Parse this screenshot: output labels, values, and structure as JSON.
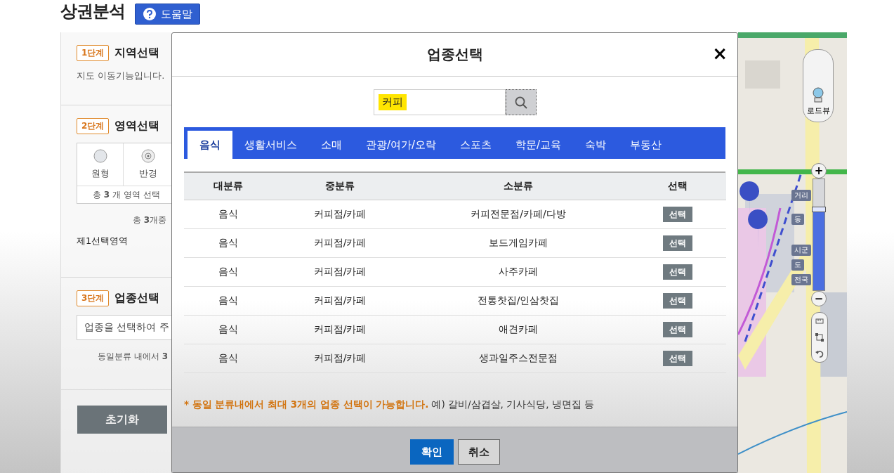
{
  "page": {
    "title": "상권분석",
    "help_button": "도움말"
  },
  "left_panel": {
    "step1": {
      "badge": "1단계",
      "title": "지역선택",
      "note": "지도 이동기능입니다."
    },
    "step2": {
      "badge": "2단계",
      "title": "영역선택",
      "shapes": [
        {
          "kind": "circle",
          "label": "원형"
        },
        {
          "kind": "radius",
          "label": "반경"
        }
      ],
      "area_count": "총 **3** 개 영역 선택",
      "selected_count": "총 **3**개중",
      "area_item": "제1선택영역"
    },
    "step3": {
      "badge": "3단계",
      "title": "업종선택",
      "field_placeholder": "업종을 선택하여 주",
      "note": "동일분류 내에서 **3**"
    },
    "reset_button": "초기화"
  },
  "modal": {
    "title": "업종선택",
    "close": "×",
    "search": {
      "value": "커피"
    },
    "tabs": [
      {
        "label": "음식",
        "selected": true
      },
      {
        "label": "생활서비스",
        "selected": false
      },
      {
        "label": "소매",
        "selected": false
      },
      {
        "label": "관광/여가/오락",
        "selected": false
      },
      {
        "label": "스포츠",
        "selected": false
      },
      {
        "label": "학문/교육",
        "selected": false
      },
      {
        "label": "숙박",
        "selected": false
      },
      {
        "label": "부동산",
        "selected": false
      }
    ],
    "table": {
      "columns": [
        "대분류",
        "중분류",
        "소분류",
        "선택"
      ],
      "rows": [
        {
          "cells": [
            "음식",
            "커피점/카페",
            "커피전문점/카페/다방"
          ],
          "button": "선택"
        },
        {
          "cells": [
            "음식",
            "커피점/카페",
            "보드게임카페"
          ],
          "button": "선택"
        },
        {
          "cells": [
            "음식",
            "커피점/카페",
            "사주카페"
          ],
          "button": "선택"
        },
        {
          "cells": [
            "음식",
            "커피점/카페",
            "전통찻집/인삼찻집"
          ],
          "button": "선택"
        },
        {
          "cells": [
            "음식",
            "커피점/카페",
            "애견카페"
          ],
          "button": "선택"
        },
        {
          "cells": [
            "음식",
            "커피점/카페",
            "생과일주스전문점"
          ],
          "button": "선택"
        }
      ]
    },
    "note_warning": "* 동일 분류내에서 최대 3개의 업종 선택이 가능합니다.",
    "note_example": "예) 갈비/삼겹살, 기사식당, 냉면집 등",
    "buttons": [
      {
        "kind": "primary",
        "label": "확인"
      },
      {
        "kind": "secondary",
        "label": "취소"
      }
    ]
  },
  "map": {
    "kind": "picture",
    "roadview_button": "로드뷰",
    "zoom": {
      "plus": "+",
      "minus": "−",
      "level": 0.73,
      "levels": [
        "거리",
        "동",
        "시군",
        "도",
        "전국"
      ]
    }
  }
}
